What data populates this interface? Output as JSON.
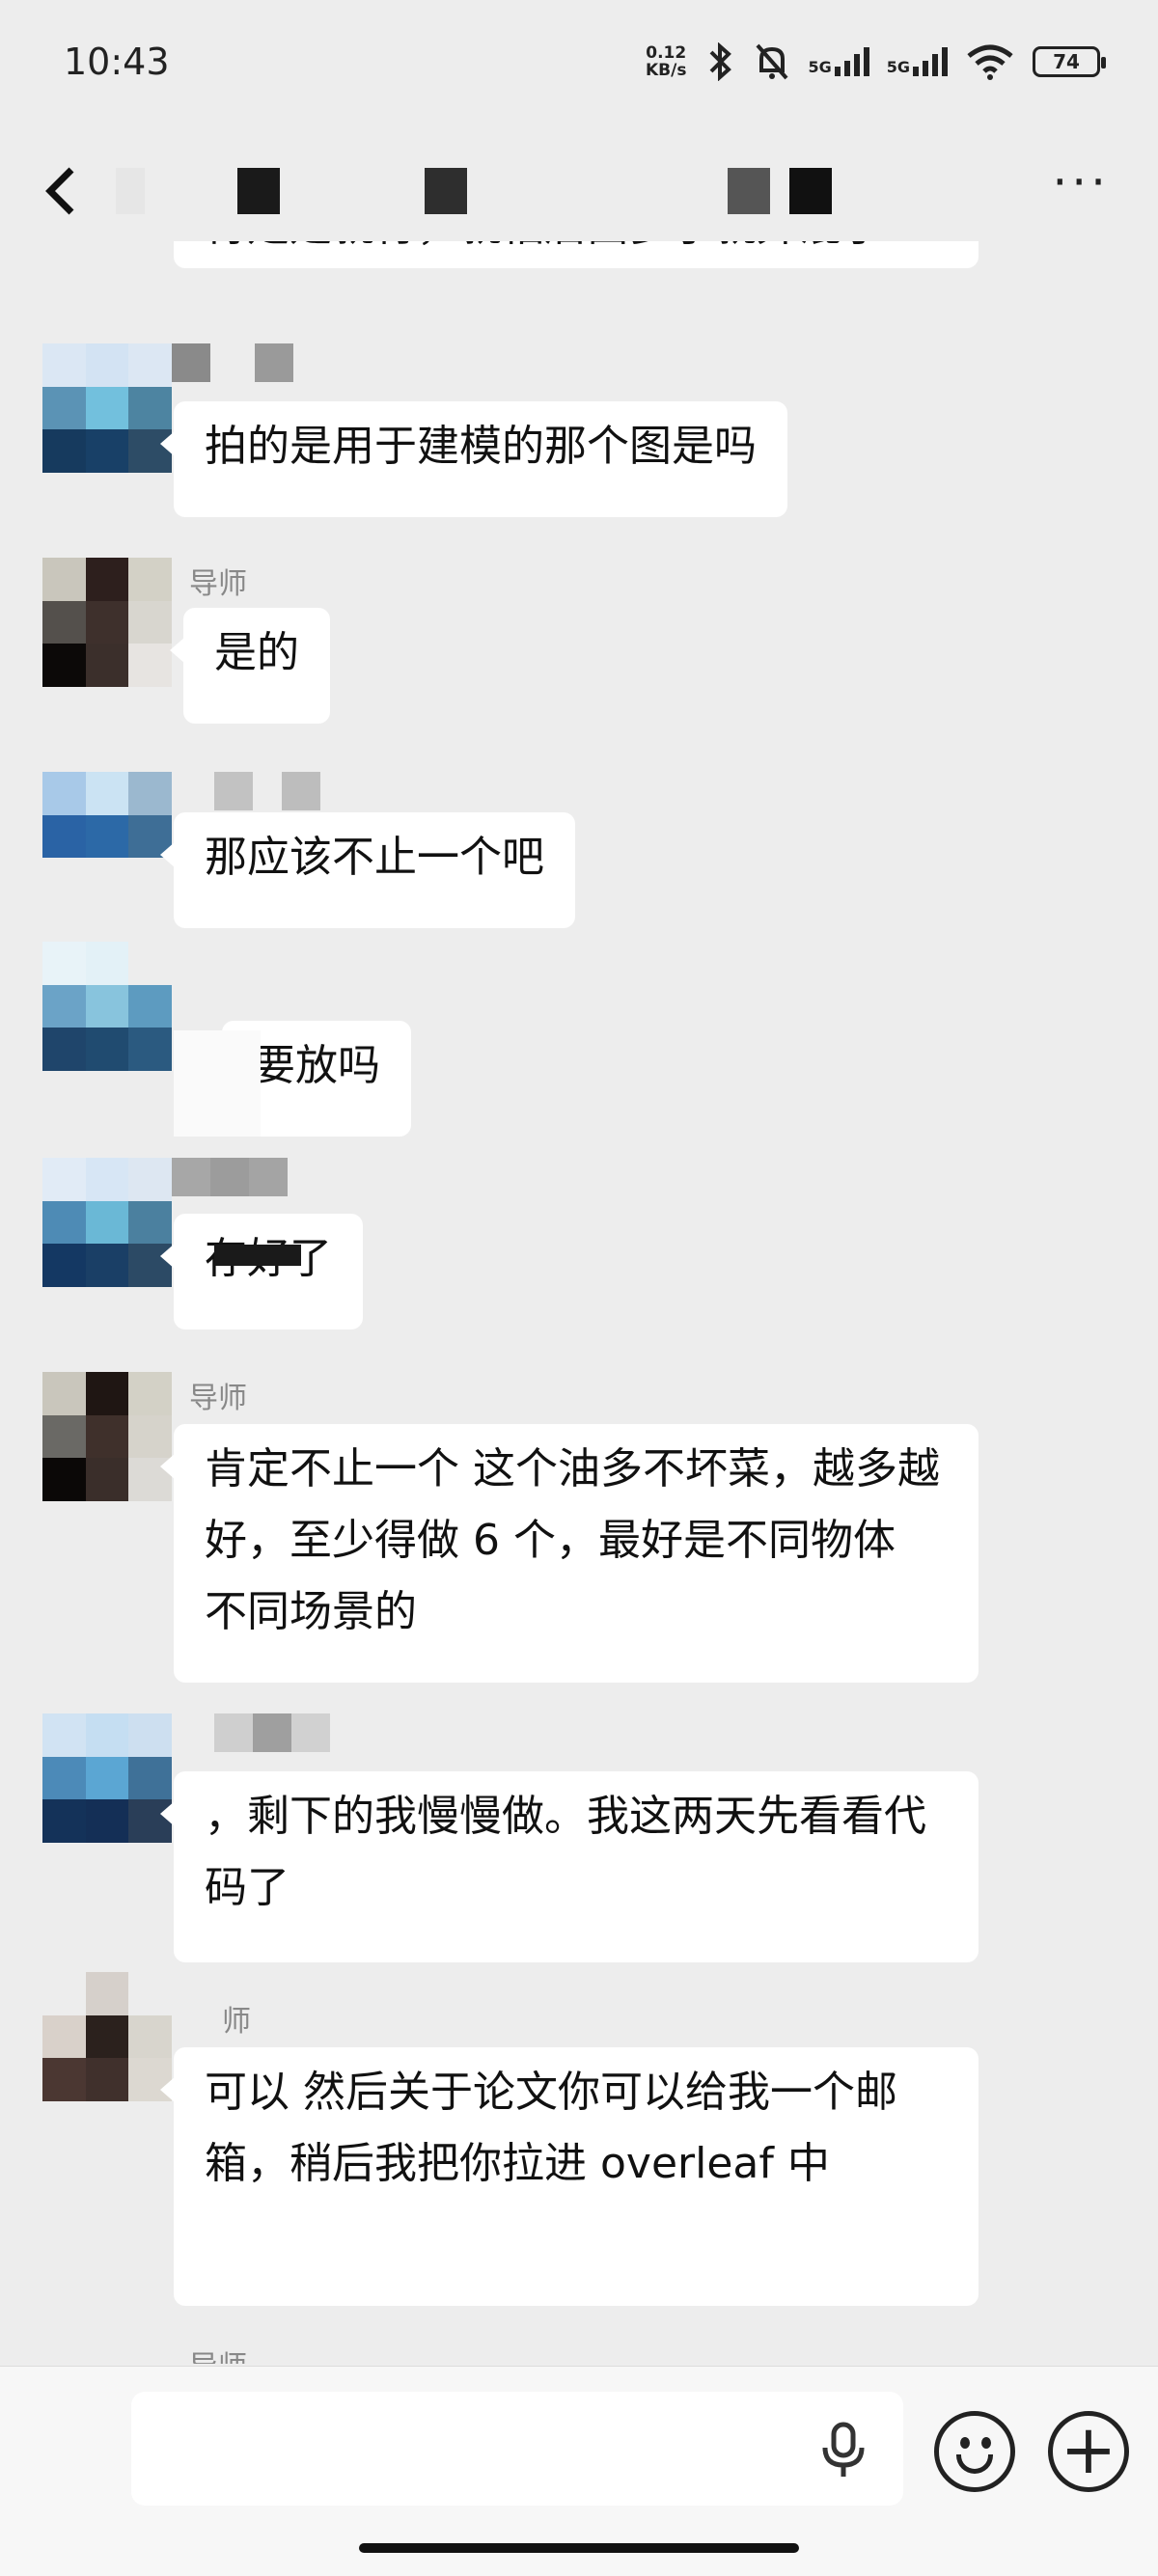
{
  "status_bar": {
    "time": "10:43",
    "net_speed_value": "0.12",
    "net_speed_unit": "KB/s",
    "signal_1": "5G",
    "signal_2": "5G",
    "battery": "74"
  },
  "header": {
    "back_label": "‹",
    "more_label": "···"
  },
  "messages": [
    {
      "sender": "",
      "text": "肯定是就行，就怕后面多了就弄混了"
    },
    {
      "sender": "",
      "text": "拍的是用于建模的那个图是吗"
    },
    {
      "sender": "导师",
      "text": "是的"
    },
    {
      "sender": "",
      "text": "那应该不止一个吧"
    },
    {
      "sender": "",
      "text": "要放吗"
    },
    {
      "sender": "",
      "text": "存好了"
    },
    {
      "sender": "导师",
      "text": "肯定不止一个  这个油多不坏菜，越多越好，至少得做 6 个，最好是不同物体  不同场景的"
    },
    {
      "sender": "",
      "text": "，剩下的我慢慢做。我这两天先看看代码了"
    },
    {
      "sender": "师",
      "text": "可以 然后关于论文你可以给我一个邮箱，稍后我把你拉进 overleaf 中"
    },
    {
      "sender": "导师",
      "text": ""
    }
  ],
  "input": {
    "mic_icon": "mic-icon",
    "emoji_icon": "emoji-icon",
    "plus_icon": "plus-icon"
  }
}
